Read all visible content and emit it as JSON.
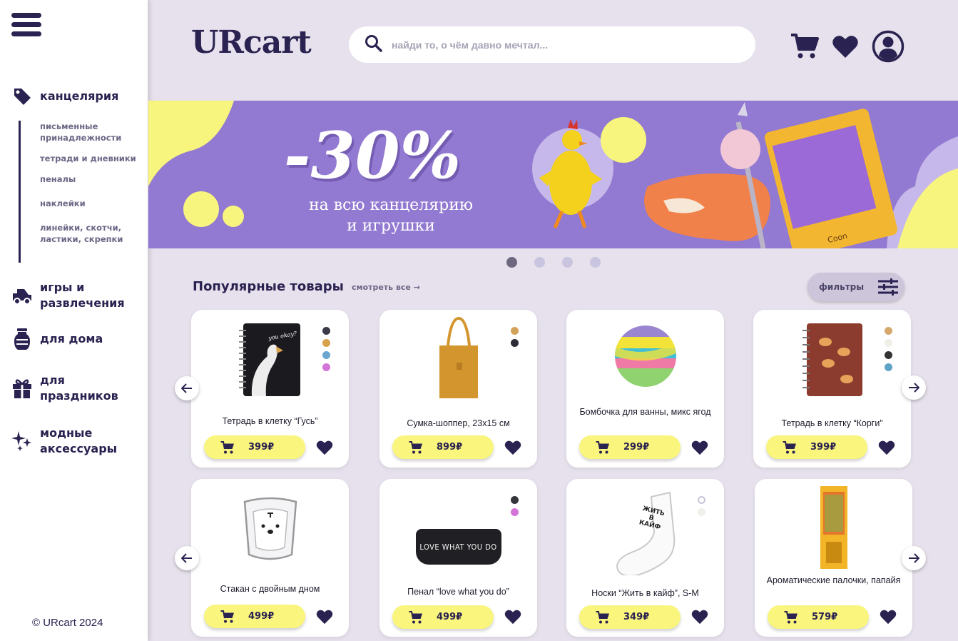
{
  "sidebar": {
    "categories": [
      {
        "label": "канцелярия",
        "icon": "tag-icon"
      },
      {
        "label": "игры и развлечения",
        "icon": "toy-car-icon"
      },
      {
        "label": "для дома",
        "icon": "vase-icon"
      },
      {
        "label": "для праздников",
        "icon": "gift-icon"
      },
      {
        "label": "модные аксессуары",
        "icon": "sparkles-icon"
      }
    ],
    "subcategories": [
      "письменные принадлежности",
      "тетради и дневники",
      "пеналы",
      "наклейки",
      "линейки, скотчи, ластики, скрепки"
    ],
    "copyright": "© URcart 2024"
  },
  "header": {
    "logo": "URcart",
    "search_placeholder": "найди то, о чём давно мечтал..."
  },
  "banner": {
    "discount": "-30%",
    "line1": "на всю канцелярию",
    "line2": "и игрушки",
    "background": "#9279d1",
    "accent": "#f8f57e"
  },
  "carousel": {
    "slides": 4,
    "active": 0
  },
  "section": {
    "title": "Популярные товары",
    "see_all": "смотреть все →",
    "filters": "фильтры"
  },
  "products": [
    {
      "name": "Тетрадь в клетку “Гусь”",
      "price": "399₽",
      "image": "goose-notebook",
      "colors": [
        "#3a3a48",
        "#d8a24c",
        "#6aa6cf",
        "#d374d8"
      ]
    },
    {
      "name": "Сумка-шоппер, 23x15 см",
      "price": "899₽",
      "image": "tote-bag",
      "colors": [
        "#d2a259",
        "#2c2c36"
      ]
    },
    {
      "name": "Бомбочка для ванны, микс ягод",
      "price": "299₽",
      "image": "bath-bomb",
      "colors": []
    },
    {
      "name": "Тетрадь в клетку “Корги”",
      "price": "399₽",
      "image": "corgi-notebook",
      "colors": [
        "#d6a86c",
        "#f1eee8",
        "#333336",
        "#5fa4c6"
      ]
    },
    {
      "name": "Стакан с двойным дном",
      "price": "499₽",
      "image": "glass-cup",
      "colors": []
    },
    {
      "name": "Пенал “love what you do”",
      "price": "499₽",
      "image": "pencil-case",
      "colors": [
        "#35353c",
        "#d374d8"
      ]
    },
    {
      "name": "Носки “Жить в кайф”, S-M",
      "price": "349₽",
      "image": "socks",
      "colors": [
        "#ffffff",
        "#f0efea"
      ]
    },
    {
      "name": "Ароматические палочки, папайя",
      "price": "579₽",
      "image": "aroma-sticks",
      "colors": []
    }
  ],
  "pencil_case_text": "LOVE WHAT YOU DO",
  "socks_text": "ЖИТЬ В КАЙФ",
  "notebook_text": "you okay?"
}
